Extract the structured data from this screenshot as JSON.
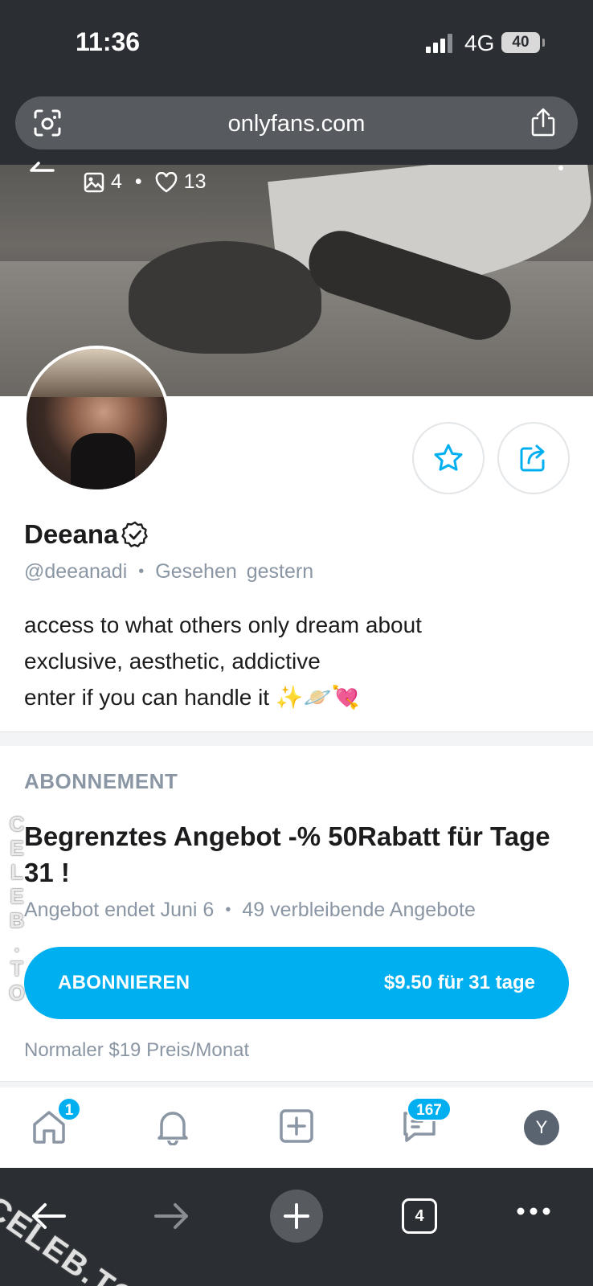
{
  "status_bar": {
    "time": "11:36",
    "network": "4G",
    "battery": "40"
  },
  "browser": {
    "url": "onlyfans.com",
    "tabs_count": "4"
  },
  "cover": {
    "media_count": "4",
    "likes_count": "13"
  },
  "profile": {
    "name": "Deeana",
    "handle": "@deeanadi",
    "seen_label": "Gesehen",
    "seen_value": "gestern",
    "bio_lines": [
      "access to what others only dream about",
      "exclusive, aesthetic, addictive",
      "enter if you can handle it ✨🪐💘"
    ]
  },
  "subscription": {
    "section_title": "ABONNEMENT",
    "offer_title": "Begrenztes Angebot -% 50Rabatt für Tage 31 !",
    "offer_ends": "Angebot endet Juni 6",
    "offers_left": "49 verbleibende Angebote",
    "button_label": "ABONNIEREN",
    "button_price": "$9.50 für 31 tage",
    "regular_price": "Normaler $19 Preis/Monat"
  },
  "app_nav": {
    "home_badge": "1",
    "messages_badge": "167",
    "avatar_initial": "Y"
  },
  "watermark": {
    "vertical": "CELEB.TO",
    "diagonal": "CELEB.TO"
  },
  "colors": {
    "accent": "#00aff0",
    "muted": "#8a96a3",
    "browser_bg": "#2b2f33"
  },
  "icons": [
    "camera-lens-icon",
    "share-icon",
    "back-arrow-icon",
    "image-icon",
    "heart-icon",
    "more-vertical-icon",
    "star-icon",
    "share-box-icon",
    "verified-icon",
    "home-icon",
    "bell-icon",
    "add-post-icon",
    "messages-icon",
    "forward-arrow-icon",
    "new-tab-icon",
    "tabs-icon",
    "more-horizontal-icon"
  ]
}
